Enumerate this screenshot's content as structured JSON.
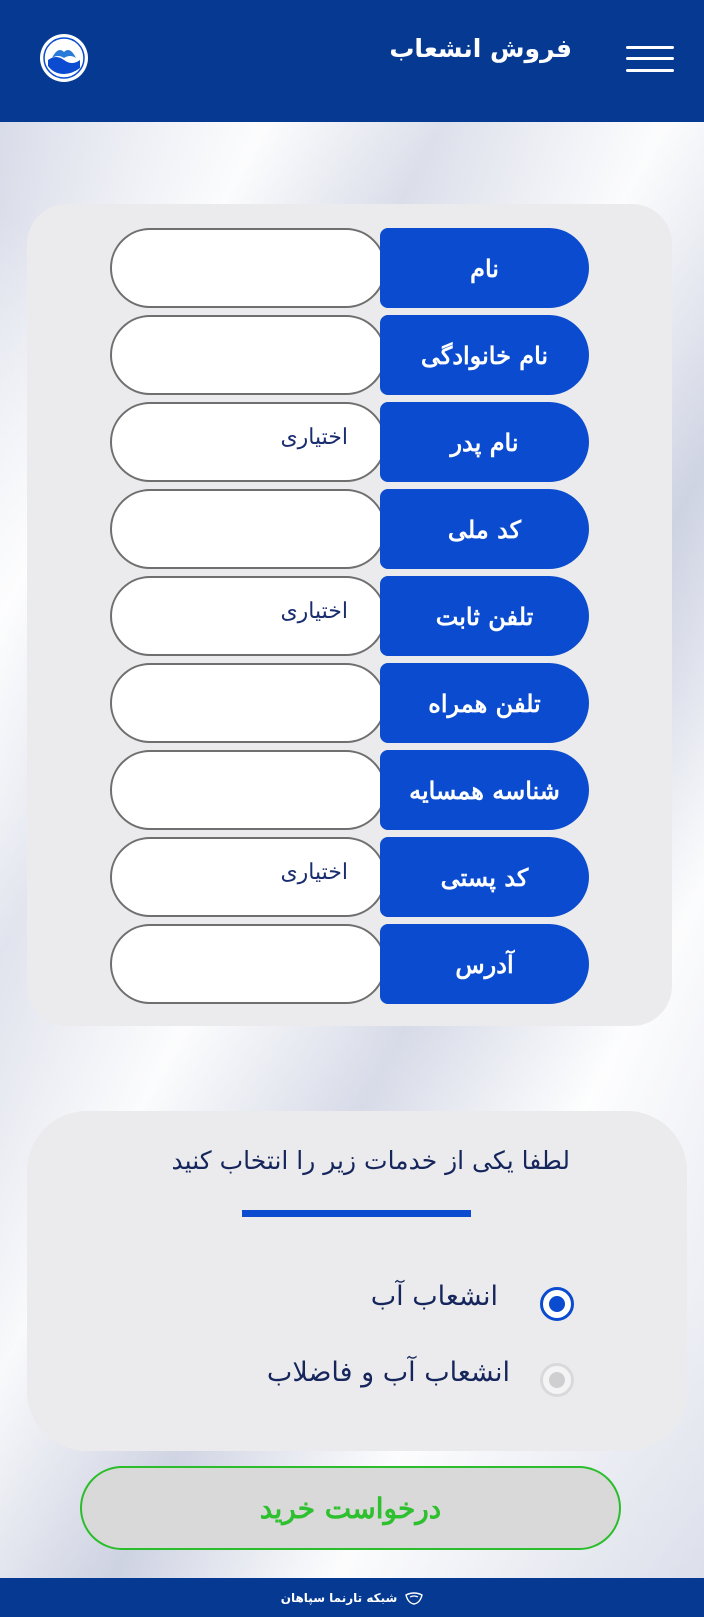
{
  "header": {
    "title": "فروش انشعاب",
    "menu_icon": "hamburger-menu-icon",
    "logo": "water-company-logo"
  },
  "form": {
    "fields": [
      {
        "label": "نام",
        "value": "",
        "placeholder": ""
      },
      {
        "label": "نام خانوادگی",
        "value": "",
        "placeholder": ""
      },
      {
        "label": "نام پدر",
        "value": "",
        "placeholder": "اختیاری"
      },
      {
        "label": "کد ملی",
        "value": "",
        "placeholder": ""
      },
      {
        "label": "تلفن ثابت",
        "value": "",
        "placeholder": "اختیاری"
      },
      {
        "label": "تلفن همراه",
        "value": "",
        "placeholder": ""
      },
      {
        "label": "شناسه همسایه",
        "value": "",
        "placeholder": ""
      },
      {
        "label": "کد پستی",
        "value": "",
        "placeholder": "اختیاری"
      },
      {
        "label": "آدرس",
        "value": "",
        "placeholder": ""
      }
    ]
  },
  "services": {
    "title": "لطفا یکی از خدمات زیر را انتخاب کنید",
    "options": [
      {
        "label": "انشعاب آب",
        "selected": true
      },
      {
        "label": "انشعاب  آب و فاضلاب",
        "selected": false
      }
    ]
  },
  "buy_button": {
    "label": "درخواست خرید"
  },
  "footer": {
    "text": "شبکه تارنما سپاهان",
    "icon": "company-logo-icon"
  },
  "colors": {
    "header": "#063a92",
    "label_bg": "#0a4bcf",
    "button_text": "#2ec02e",
    "button_border": "#2bbd2b"
  }
}
